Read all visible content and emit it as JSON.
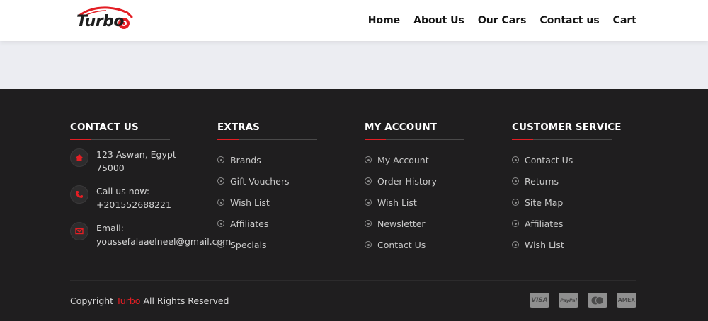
{
  "header": {
    "logo_text": "Turbo",
    "nav": [
      "Home",
      "About Us",
      "Our Cars",
      "Contact us",
      "Cart"
    ]
  },
  "footer": {
    "contact": {
      "title": "CONTACT US",
      "address_line1": "123 Aswan, Egypt",
      "address_line2": "75000",
      "phone_label": "Call us now:",
      "phone": "+201552688221",
      "email_label": "Email:",
      "email": "youssefalaaelneel@gmail.com"
    },
    "extras": {
      "title": "EXTRAS",
      "items": [
        "Brands",
        "Gift Vouchers",
        "Wish List",
        "Affiliates",
        "Specials"
      ]
    },
    "account": {
      "title": "MY ACCOUNT",
      "items": [
        "My Account",
        "Order History",
        "Wish List",
        "Newsletter",
        "Contact Us"
      ]
    },
    "service": {
      "title": "CUSTOMER SERVICE",
      "items": [
        "Contact Us",
        "Returns",
        "Site Map",
        "Affiliates",
        "Wish List"
      ]
    },
    "copyright": {
      "prefix": "Copyright",
      "brand": "Turbo",
      "suffix": "All Rights Reserved"
    },
    "payments": [
      "VISA",
      "PayPal",
      "mastercard",
      "AMEX"
    ]
  },
  "colors": {
    "accent": "#e31e24",
    "footer_bg": "#1f1e1f",
    "band_bg": "#ecedf2"
  }
}
